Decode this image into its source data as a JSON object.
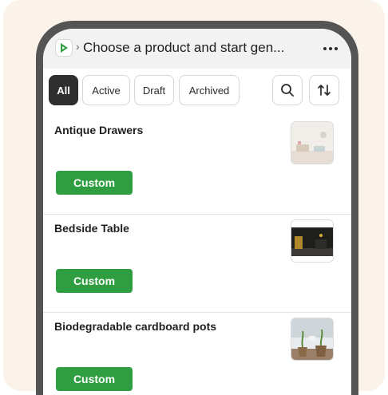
{
  "header": {
    "title": "Choose a product and start gen...",
    "breadcrumb_separator": "›",
    "app_icon": "app-logo-icon",
    "more_icon": "more-horizontal-icon"
  },
  "filters": {
    "tabs": [
      {
        "label": "All",
        "selected": true
      },
      {
        "label": "Active",
        "selected": false
      },
      {
        "label": "Draft",
        "selected": false
      },
      {
        "label": "Archived",
        "selected": false
      }
    ],
    "search_icon": "search-icon",
    "sort_icon": "sort-icon"
  },
  "products": [
    {
      "name": "Antique Drawers",
      "action_label": "Custom",
      "thumbnail": "drawers-thumbnail"
    },
    {
      "name": "Bedside Table",
      "action_label": "Custom",
      "thumbnail": "bedside-table-thumbnail"
    },
    {
      "name": "Biodegradable cardboard pots",
      "action_label": "Custom",
      "thumbnail": "cardboard-pots-thumbnail"
    }
  ],
  "colors": {
    "accent": "#2e9e41",
    "selected_chip": "#2f2f2f",
    "backdrop": "#fbf3ea",
    "device_frame": "#545454"
  }
}
